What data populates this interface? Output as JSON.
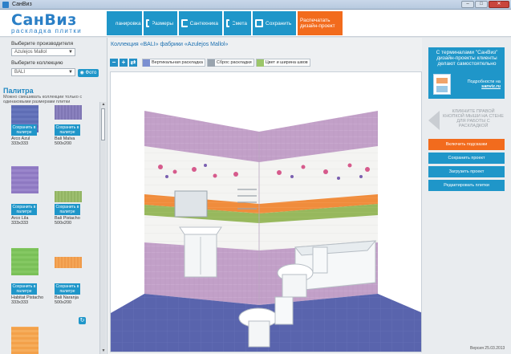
{
  "window": {
    "title": "СанВиз",
    "minimize": "–",
    "maximize": "□",
    "close": "✕"
  },
  "logo": {
    "brand": "СанВиз",
    "tagline": "раскладка плитки"
  },
  "nav": [
    {
      "label": "Планировка",
      "icon": "floorplan-icon"
    },
    {
      "label": "Размеры",
      "icon": "ruler-icon"
    },
    {
      "label": "Сантехника",
      "icon": "bath-icon"
    },
    {
      "label": "Смета",
      "icon": "estimate-icon"
    },
    {
      "label": "Сохранить",
      "icon": "save-icon"
    },
    {
      "label": "Распечатать дизайн-проект",
      "icon": "print-icon"
    }
  ],
  "left": {
    "manufacturer_label": "Выберите производителя",
    "manufacturer_value": "Azulejos Mallol",
    "collection_label": "Выберите коллекцию",
    "collection_value": "BALI",
    "photo_button": "Фото",
    "palette_title": "Палитра",
    "palette_note": "Можно смешивать коллекции только с одинаковыми размерами плитки",
    "save_label": "Сохранить в палитре",
    "tiles": [
      {
        "name": "Arco Azul",
        "size": "333x333",
        "color": "#5e6db5"
      },
      {
        "name": "Bali Malva",
        "size": "500x200",
        "color": "#7f76b4"
      },
      {
        "name": "Arco Lila",
        "size": "333x333",
        "color": "#8e79c2"
      },
      {
        "name": "Bali Pistacho",
        "size": "500x200",
        "color": "#92b463"
      },
      {
        "name": "Habitat Pistacho",
        "size": "333x333",
        "color": "#7ac058"
      },
      {
        "name": "Bali Naranja",
        "size": "500x200",
        "color": "#ef9a4a"
      },
      {
        "name": "",
        "size": "",
        "color": "#f3a14a"
      }
    ]
  },
  "main": {
    "collection_title": "Коллекция «BALI» фабрики «Azulejos Mallol»",
    "toolbar": {
      "vertical": "Вертикальная раскладка",
      "reset": "Сброс раскладки",
      "seam": "Цвет и ширина швов"
    }
  },
  "right": {
    "promo_text": "С терминалами \"СанВиз\" дизайн-проекты клиенты делают самостоятельно",
    "promo_more": "Подробности на",
    "promo_link": "sanviz.ru",
    "hint": "КЛИКНИТЕ ПРАВОЙ КНОПКОЙ МЫШИ НА СТЕНЕ ДЛЯ РАБОТЫ С РАСКЛАДКОЙ",
    "buttons": [
      "Включить подсказки",
      "Сохранить проект",
      "Загрузить проект",
      "Редактировать плитки"
    ],
    "version": "Версия 25.03.2013"
  },
  "colors": {
    "accent": "#1f96c9",
    "orange": "#f26b1d",
    "brand": "#2a7fc6"
  }
}
